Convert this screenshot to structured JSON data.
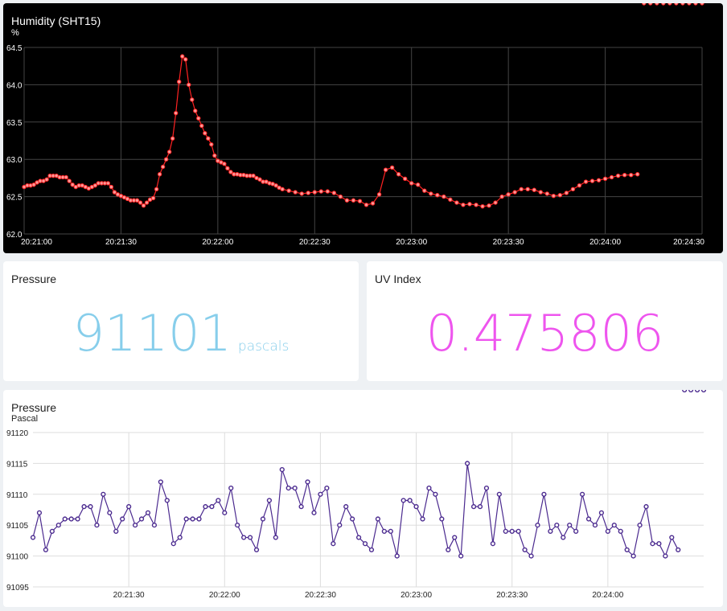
{
  "humidity": {
    "title": "Humidity (SHT15)",
    "unit": "%",
    "colors": {
      "line": "#ff2222",
      "grid": "#444444",
      "text": "#ffffff"
    },
    "chart_data": {
      "type": "line",
      "title": "Humidity (SHT15)",
      "ylabel": "%",
      "ylim": [
        62.0,
        64.5
      ],
      "yticks": [
        "62.0",
        "62.5",
        "63.0",
        "63.5",
        "64.0",
        "64.5"
      ],
      "xticks": [
        "20:21:00",
        "20:21:30",
        "20:22:00",
        "20:22:30",
        "20:23:00",
        "20:23:30",
        "20:24:00",
        "20:24:30"
      ],
      "xrange_seconds": [
        0,
        210
      ],
      "x": [
        0,
        1,
        2,
        3,
        4,
        5,
        6,
        7,
        8,
        9,
        10,
        11,
        12,
        13,
        14,
        15,
        16,
        17,
        18,
        19,
        20,
        21,
        22,
        23,
        24,
        25,
        26,
        27,
        28,
        29,
        30,
        31,
        32,
        33,
        34,
        35,
        36,
        37,
        38,
        39,
        40,
        41,
        42,
        43,
        44,
        45,
        46,
        47,
        48,
        49,
        50,
        51,
        52,
        53,
        54,
        55,
        56,
        57,
        58,
        59,
        60,
        61,
        62,
        63,
        64,
        65,
        66,
        67,
        68,
        69,
        70,
        71,
        72,
        73,
        74,
        75,
        76,
        77,
        78,
        79,
        80,
        82,
        84,
        86,
        88,
        90,
        92,
        94,
        96,
        98,
        100,
        102,
        104,
        106,
        108,
        110,
        112,
        114,
        116,
        118,
        120,
        122,
        124,
        126,
        128,
        130,
        132,
        134,
        136,
        138,
        140,
        142,
        144,
        146,
        148,
        150,
        152,
        154,
        156,
        158,
        160,
        162,
        164,
        166,
        168,
        170,
        172,
        174,
        176,
        178,
        180,
        182,
        184,
        186,
        188,
        190,
        192,
        194,
        196,
        198,
        200,
        202,
        204,
        206,
        208,
        210
      ],
      "series": [
        {
          "values": [
            62.63,
            62.65,
            62.65,
            62.66,
            62.69,
            62.71,
            62.71,
            62.73,
            62.78,
            62.78,
            62.78,
            62.76,
            62.76,
            62.76,
            62.71,
            62.66,
            62.63,
            62.65,
            62.65,
            62.63,
            62.61,
            62.63,
            62.65,
            62.68,
            62.68,
            62.68,
            62.68,
            62.63,
            62.56,
            62.53,
            62.51,
            62.49,
            62.47,
            62.45,
            62.45,
            62.45,
            62.42,
            62.38,
            62.42,
            62.46,
            62.48,
            62.6,
            62.8,
            62.9,
            63.0,
            63.1,
            63.28,
            63.62,
            64.04,
            64.38,
            64.34,
            64.0,
            63.8,
            63.65,
            63.55,
            63.45,
            63.35,
            63.28,
            63.2,
            63.05,
            62.98,
            62.96,
            62.94,
            62.88,
            62.83,
            62.8,
            62.8,
            62.79,
            62.79,
            62.78,
            62.78,
            62.78,
            62.75,
            62.73,
            62.7,
            62.7,
            62.68,
            62.67,
            62.65,
            62.62,
            62.6,
            62.58,
            62.56,
            62.54,
            62.55,
            62.56,
            62.57,
            62.57,
            62.55,
            62.5,
            62.45,
            62.45,
            62.44,
            62.39,
            62.41,
            62.53,
            62.86,
            62.89,
            62.8,
            62.74,
            62.68,
            62.66,
            62.58,
            62.54,
            62.52,
            62.5,
            62.46,
            62.42,
            62.39,
            62.4,
            62.39,
            62.37,
            62.38,
            62.42,
            62.5,
            62.53,
            62.56,
            62.6,
            62.6,
            62.59,
            62.56,
            62.54,
            62.51,
            62.52,
            62.55,
            62.6,
            62.65,
            62.7,
            62.71,
            62.72,
            62.74,
            62.76,
            62.78,
            62.79,
            62.79,
            62.8
          ]
        }
      ],
      "grid": true,
      "legend": "none"
    }
  },
  "pressure_value": {
    "title": "Pressure",
    "value": "91101",
    "unit": "pascals",
    "color": "#87ceeb"
  },
  "uv": {
    "title": "UV Index",
    "value": "0.475806",
    "color": "#ee55ee"
  },
  "pressure_chart": {
    "title": "Pressure",
    "unit": "Pascal",
    "colors": {
      "line": "#4b2a8f",
      "marker": "#4b2a8f",
      "grid": "#dddddd",
      "text": "#222222"
    },
    "chart_data": {
      "type": "line",
      "title": "Pressure",
      "ylabel": "Pascal",
      "ylim": [
        91095,
        91120
      ],
      "yticks": [
        "91095",
        "91100",
        "91105",
        "91110",
        "91115",
        "91120"
      ],
      "xticks": [
        "20:21:30",
        "20:22:00",
        "20:22:30",
        "20:23:00",
        "20:23:30",
        "20:24:00"
      ],
      "xrange_seconds": [
        0,
        210
      ],
      "x": [
        0,
        2,
        4,
        6,
        8,
        10,
        12,
        14,
        16,
        18,
        20,
        22,
        24,
        26,
        28,
        30,
        32,
        34,
        36,
        38,
        40,
        42,
        44,
        46,
        48,
        50,
        52,
        54,
        56,
        58,
        60,
        62,
        64,
        66,
        68,
        70,
        72,
        74,
        76,
        78,
        80,
        82,
        84,
        86,
        88,
        90,
        92,
        94,
        96,
        98,
        100,
        102,
        104,
        106,
        108,
        110,
        112,
        114,
        116,
        118,
        120,
        122,
        124,
        126,
        128,
        130,
        132,
        134,
        136,
        138,
        140,
        142,
        144,
        146,
        148,
        150,
        152,
        154,
        156,
        158,
        160,
        162,
        164,
        166,
        168,
        170,
        172,
        174,
        176,
        178,
        180,
        182,
        184,
        186,
        188,
        190,
        192,
        194,
        196,
        198,
        200,
        202,
        204,
        206,
        208,
        210
      ],
      "series": [
        {
          "values": [
            91103,
            91107,
            91101,
            91104,
            91105,
            91106,
            91106,
            91106,
            91108,
            91108,
            91105,
            91110,
            91107,
            91104,
            91106,
            91108,
            91105,
            91106,
            91107,
            91105,
            91112,
            91109,
            91102,
            91103,
            91106,
            91106,
            91106,
            91108,
            91108,
            91109,
            91107,
            91111,
            91105,
            91103,
            91103,
            91101,
            91106,
            91109,
            91103,
            91114,
            91111,
            91111,
            91108,
            91112,
            91107,
            91110,
            91111,
            91102,
            91105,
            91108,
            91106,
            91103,
            91102,
            91101,
            91106,
            91104,
            91104,
            91100,
            91109,
            91109,
            91108,
            91106,
            91111,
            91110,
            91106,
            91101,
            91103,
            91100,
            91115,
            91108,
            91108,
            91111,
            91102,
            91110,
            91104,
            91104,
            91104,
            91101,
            91100,
            91105,
            91110,
            91104,
            91105,
            91103,
            91105,
            91104,
            91110,
            91106,
            91105,
            91107,
            91104,
            91105,
            91104,
            91101,
            91100,
            91105,
            91108,
            91102,
            91102,
            91100,
            91103,
            91101
          ]
        }
      ],
      "grid": true,
      "legend": "none"
    }
  }
}
